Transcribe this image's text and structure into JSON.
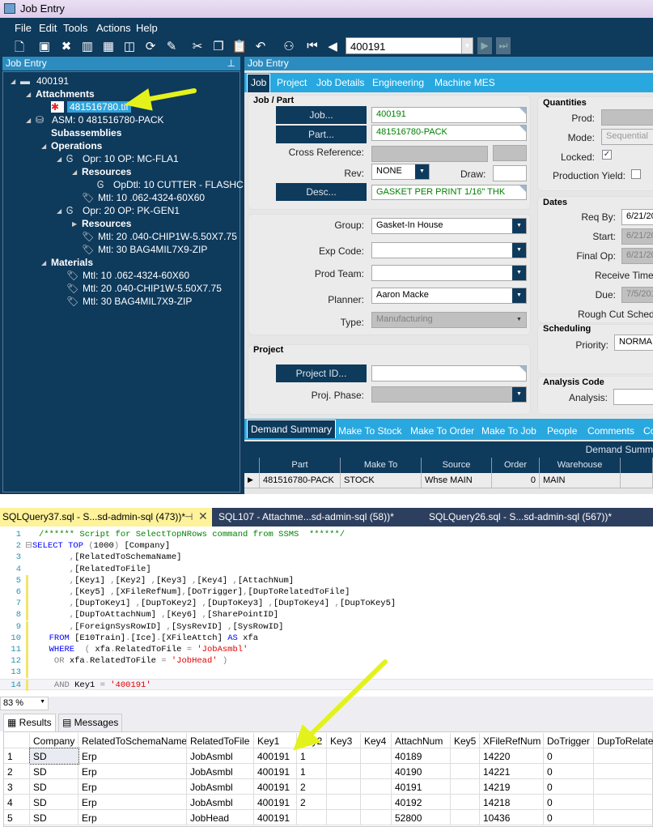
{
  "window": {
    "title": "Job Entry"
  },
  "menu": [
    "File",
    "Edit",
    "Tools",
    "Actions",
    "Help"
  ],
  "toolbar": {
    "icons": [
      "new-icon",
      "save-icon",
      "delete-icon",
      "book-icon",
      "grid-icon",
      "folder-icon",
      "refresh-icon",
      "clear-icon",
      "cut-icon",
      "copy-icon",
      "paste-icon",
      "undo-icon",
      "binoculars-icon",
      "first-icon",
      "prev-icon"
    ],
    "nav_value": "400191"
  },
  "left_panel": {
    "title": "Job Entry",
    "tree": [
      {
        "label": "400191",
        "depth": 0,
        "expander": "open",
        "icon": "folder",
        "bold": false
      },
      {
        "label": "Attachments",
        "depth": 1,
        "expander": "open",
        "icon": "",
        "bold": true
      },
      {
        "label": "481516780.tif",
        "depth": 2,
        "expander": "",
        "icon": "tif",
        "bold": false,
        "selected": true
      },
      {
        "label": "ASM: 0 481516780-PACK",
        "depth": 1,
        "expander": "open",
        "icon": "assembly",
        "bold": false
      },
      {
        "label": "Subassemblies",
        "depth": 2,
        "expander": "",
        "icon": "",
        "bold": true
      },
      {
        "label": "Operations",
        "depth": 2,
        "expander": "open",
        "icon": "",
        "bold": true
      },
      {
        "label": "Opr: 10 OP: MC-FLA1",
        "depth": 3,
        "expander": "open",
        "icon": "operation",
        "bold": false
      },
      {
        "label": "Resources",
        "depth": 4,
        "expander": "open",
        "icon": "",
        "bold": true
      },
      {
        "label": "OpDtl: 10 CUTTER - FLASHC",
        "depth": 5,
        "expander": "",
        "icon": "opdetail",
        "bold": false
      },
      {
        "label": "Mtl: 10 .062-4324-60X60",
        "depth": 4,
        "expander": "",
        "icon": "material-flag",
        "bold": false
      },
      {
        "label": "Opr: 20 OP: PK-GEN1",
        "depth": 3,
        "expander": "open",
        "icon": "operation",
        "bold": false
      },
      {
        "label": "Resources",
        "depth": 4,
        "expander": "closed",
        "icon": "",
        "bold": true
      },
      {
        "label": "Mtl: 20 .040-CHIP1W-5.50X7.75",
        "depth": 4,
        "expander": "",
        "icon": "material",
        "bold": false
      },
      {
        "label": "Mtl: 30 BAG4MIL7X9-ZIP",
        "depth": 4,
        "expander": "",
        "icon": "material",
        "bold": false
      },
      {
        "label": "Materials",
        "depth": 2,
        "expander": "open",
        "icon": "",
        "bold": true
      },
      {
        "label": "Mtl: 10 .062-4324-60X60",
        "depth": 3,
        "expander": "",
        "icon": "material-flag",
        "bold": false
      },
      {
        "label": "Mtl: 20 .040-CHIP1W-5.50X7.75",
        "depth": 3,
        "expander": "",
        "icon": "material",
        "bold": false
      },
      {
        "label": "Mtl: 30 BAG4MIL7X9-ZIP",
        "depth": 3,
        "expander": "",
        "icon": "material",
        "bold": false
      }
    ]
  },
  "right_panel": {
    "title": "Job Entry",
    "tabs": [
      "Job",
      "Project",
      "Job Details",
      "Engineering",
      "Machine MES"
    ],
    "job_part": {
      "heading": "Job / Part",
      "job_btn": "Job...",
      "job": "400191",
      "part_btn": "Part...",
      "part": "481516780-PACK",
      "xref_label": "Cross Reference:",
      "rev_label": "Rev:",
      "rev": "NONE",
      "draw_label": "Draw:",
      "desc_btn": "Desc...",
      "desc": "GASKET PER PRINT 1/16\" THK"
    },
    "group": {
      "group_label": "Group:",
      "group": "Gasket-In House",
      "exp_label": "Exp Code:",
      "team_label": "Prod Team:",
      "planner_label": "Planner:",
      "planner": "Aaron Macke",
      "type_label": "Type:",
      "type": "Manufacturing"
    },
    "project": {
      "heading": "Project",
      "id_btn": "Project ID...",
      "phase_label": "Proj. Phase:"
    },
    "quantities": {
      "heading": "Quantities",
      "prod_label": "Prod:",
      "mode_label": "Mode:",
      "mode": "Sequential",
      "locked_label": "Locked:",
      "locked": true,
      "yield_label": "Production Yield:",
      "yield": false
    },
    "dates": {
      "heading": "Dates",
      "req_label": "Req By:",
      "req": "6/21/20",
      "start_label": "Start:",
      "start": "6/21/20",
      "final_label": "Final Op:",
      "final": "6/21/20",
      "receive_label": "Receive Time",
      "due_label": "Due:",
      "due": "7/5/201",
      "rough_label": "Rough Cut Sched"
    },
    "scheduling": {
      "heading": "Scheduling",
      "priority_label": "Priority:",
      "priority": "NORMA"
    },
    "analysis": {
      "heading": "Analysis Code",
      "analysis_label": "Analysis:"
    },
    "bottom_tabs": [
      "Demand Summary",
      "Make To Stock",
      "Make To Order",
      "Make To Job",
      "People",
      "Comments",
      "Co"
    ],
    "demand": {
      "title": "Demand Summ",
      "columns": [
        "Part",
        "Make To",
        "Source",
        "Order",
        "Warehouse",
        ""
      ],
      "rows": [
        [
          "481516780-PACK",
          "STOCK",
          "Whse MAIN",
          "0",
          "MAIN",
          ""
        ]
      ]
    }
  },
  "ssms": {
    "tabs": [
      "SQLQuery37.sql - S...sd-admin-sql (473))*",
      "SQL107 - Attachme...sd-admin-sql (58))*",
      "SQLQuery26.sql - S...sd-admin-sql (567))*"
    ],
    "code": [
      [
        [
          "c",
          "/****** Script for SelectTopNRows command from SSMS  ******/"
        ]
      ],
      [
        [
          "k",
          "SELECT TOP "
        ],
        [
          "g",
          "("
        ],
        [
          "t",
          "1000"
        ],
        [
          "g",
          ") "
        ],
        [
          "t",
          "[Company]"
        ]
      ],
      [
        [
          "g",
          "      ,"
        ],
        [
          "t",
          "[RelatedToSchemaName]"
        ]
      ],
      [
        [
          "g",
          "      ,"
        ],
        [
          "t",
          "[RelatedToFile]"
        ]
      ],
      [
        [
          "g",
          "      ,"
        ],
        [
          "t",
          "[Key1] "
        ],
        [
          "g",
          ","
        ],
        [
          "t",
          "[Key2] "
        ],
        [
          "g",
          ","
        ],
        [
          "t",
          "[Key3] "
        ],
        [
          "g",
          ","
        ],
        [
          "t",
          "[Key4] "
        ],
        [
          "g",
          ","
        ],
        [
          "t",
          "[AttachNum]"
        ]
      ],
      [
        [
          "g",
          "      ,"
        ],
        [
          "t",
          "[Key5] "
        ],
        [
          "g",
          ","
        ],
        [
          "t",
          "[XFileRefNum]"
        ],
        [
          "g",
          ","
        ],
        [
          "t",
          "[DoTrigger]"
        ],
        [
          "g",
          ","
        ],
        [
          "t",
          "[DupToRelatedToFile]"
        ]
      ],
      [
        [
          "g",
          "      ,"
        ],
        [
          "t",
          "[DupToKey1] "
        ],
        [
          "g",
          ","
        ],
        [
          "t",
          "[DupToKey2] "
        ],
        [
          "g",
          ","
        ],
        [
          "t",
          "[DupToKey3] "
        ],
        [
          "g",
          ","
        ],
        [
          "t",
          "[DupToKey4] "
        ],
        [
          "g",
          ","
        ],
        [
          "t",
          "[DupToKey5]"
        ]
      ],
      [
        [
          "g",
          "      ,"
        ],
        [
          "t",
          "[DupToAttachNum] "
        ],
        [
          "g",
          ","
        ],
        [
          "t",
          "[Key6] "
        ],
        [
          "g",
          ","
        ],
        [
          "t",
          "[SharePointID]"
        ]
      ],
      [
        [
          "g",
          "      ,"
        ],
        [
          "t",
          "[ForeignSysRowID] "
        ],
        [
          "g",
          ","
        ],
        [
          "t",
          "[SysRevID] "
        ],
        [
          "g",
          ","
        ],
        [
          "t",
          "[SysRowID]"
        ]
      ],
      [
        [
          "k",
          "  FROM "
        ],
        [
          "t",
          "[E10Train]"
        ],
        [
          "g",
          "."
        ],
        [
          "t",
          "[Ice]"
        ],
        [
          "g",
          "."
        ],
        [
          "t",
          "[XFileAttch] "
        ],
        [
          "k",
          "AS "
        ],
        [
          "t",
          "xfa"
        ]
      ],
      [
        [
          "k",
          "  WHERE  "
        ],
        [
          "g",
          "( "
        ],
        [
          "t",
          "xfa"
        ],
        [
          "g",
          "."
        ],
        [
          "t",
          "RelatedToFile "
        ],
        [
          "g",
          "= "
        ],
        [
          "s",
          "'JobAsmbl'"
        ]
      ],
      [
        [
          "g",
          "   OR "
        ],
        [
          "t",
          "xfa"
        ],
        [
          "g",
          "."
        ],
        [
          "t",
          "RelatedToFile "
        ],
        [
          "g",
          "= "
        ],
        [
          "s",
          "'JobHead'"
        ],
        [
          "g",
          " )"
        ]
      ],
      [],
      [
        [
          "g",
          "   AND "
        ],
        [
          "t",
          "Key1 "
        ],
        [
          "g",
          "= "
        ],
        [
          "s",
          "'400191'"
        ]
      ]
    ],
    "zoom": "83 %",
    "result_tabs": [
      "Results",
      "Messages"
    ],
    "columns": [
      "",
      "Company",
      "RelatedToSchemaName",
      "RelatedToFile",
      "Key1",
      "Key2",
      "Key3",
      "Key4",
      "AttachNum",
      "Key5",
      "XFileRefNum",
      "DoTrigger",
      "DupToRelated"
    ],
    "rows": [
      [
        "1",
        "SD",
        "Erp",
        "JobAsmbl",
        "400191",
        "1",
        "",
        "",
        "40189",
        "",
        "14220",
        "0",
        ""
      ],
      [
        "2",
        "SD",
        "Erp",
        "JobAsmbl",
        "400191",
        "1",
        "",
        "",
        "40190",
        "",
        "14221",
        "0",
        ""
      ],
      [
        "3",
        "SD",
        "Erp",
        "JobAsmbl",
        "400191",
        "2",
        "",
        "",
        "40191",
        "",
        "14219",
        "0",
        ""
      ],
      [
        "4",
        "SD",
        "Erp",
        "JobAsmbl",
        "400191",
        "2",
        "",
        "",
        "40192",
        "",
        "14218",
        "0",
        ""
      ],
      [
        "5",
        "SD",
        "Erp",
        "JobHead",
        "400191",
        "",
        "",
        "",
        "52800",
        "",
        "10436",
        "0",
        ""
      ]
    ]
  },
  "colors": {
    "navy": "#0e3a5c",
    "accent": "#29a8e0",
    "arrow": "#e4f21c"
  }
}
